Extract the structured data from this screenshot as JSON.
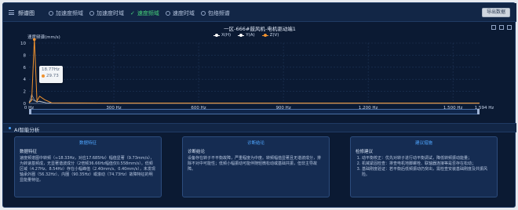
{
  "header": {
    "title": "频谱图",
    "options": [
      {
        "label": "加速度频域",
        "checked": false
      },
      {
        "label": "加速度时域",
        "checked": false
      },
      {
        "label": "速度频域",
        "checked": true
      },
      {
        "label": "速度时域",
        "checked": false
      },
      {
        "label": "包络频谱",
        "checked": false
      }
    ],
    "export_label": "导出数据"
  },
  "chart": {
    "title": "一区-666#鼓风机-电机驱动端1",
    "ylabel": "速度频谱(mm/s)",
    "legend": [
      {
        "name": "X(H)",
        "color": "#ffffff"
      },
      {
        "name": "Y(A)",
        "color": "#ffffff"
      },
      {
        "name": "Z(V)",
        "color": "#f0922e"
      }
    ],
    "tooltip": {
      "freq": "18.77Hz",
      "value": "29.73"
    }
  },
  "chart_data": {
    "type": "line",
    "title": "一区-666#鼓风机-电机驱动端1",
    "ylabel": "速度频谱(mm/s)",
    "xlabel": "",
    "xlim": [
      0,
      1594
    ],
    "ylim": [
      0,
      10
    ],
    "x_ticks": [
      "0 Hz",
      "300 Hz",
      "600 Hz",
      "900 Hz",
      "1,200 Hz",
      "1,500 Hz",
      "1,594 Hz"
    ],
    "y_ticks": [
      "0",
      "2",
      "4",
      "6",
      "8",
      "10"
    ],
    "series": [
      {
        "name": "X(H)",
        "color": "#ffffff",
        "points": [
          [
            0,
            0.1
          ],
          [
            9.4,
            1.5
          ],
          [
            18.77,
            0.6
          ],
          [
            28,
            0.2
          ],
          [
            37.5,
            0.4
          ],
          [
            60,
            0.1
          ],
          [
            300,
            0.05
          ],
          [
            600,
            0.05
          ],
          [
            900,
            0.05
          ],
          [
            1200,
            0.05
          ],
          [
            1594,
            0.05
          ]
        ]
      },
      {
        "name": "Y(A)",
        "color": "#ffffff",
        "points": [
          [
            0,
            0.1
          ],
          [
            9.4,
            0.8
          ],
          [
            18.77,
            0.4
          ],
          [
            37.5,
            0.3
          ],
          [
            60,
            0.1
          ],
          [
            300,
            0.05
          ],
          [
            600,
            0.05
          ],
          [
            900,
            0.05
          ],
          [
            1200,
            0.05
          ],
          [
            1594,
            0.05
          ]
        ]
      },
      {
        "name": "Z(V)",
        "color": "#f0922e",
        "points": [
          [
            0,
            0.1
          ],
          [
            9.4,
            0.5
          ],
          [
            18.77,
            29.73
          ],
          [
            28,
            0.4
          ],
          [
            37.5,
            1.2
          ],
          [
            56,
            0.6
          ],
          [
            80,
            0.1
          ],
          [
            300,
            0.05
          ],
          [
            600,
            0.05
          ],
          [
            900,
            0.05
          ],
          [
            1200,
            0.05
          ],
          [
            1594,
            0.05
          ]
        ]
      }
    ],
    "grid": true,
    "legend_position": "top-center"
  },
  "ai": {
    "title": "AI智能分析",
    "cards": [
      {
        "title": "数据特征",
        "subtitle": "数据特征",
        "body": "速度频谱图中转频（≈18.33Hz，对应17.685Hz）幅值显著（9.73mm/s），为转速基频成，无显著谐波成分（2倍频36.66Hz幅值仅0.558mm/s）。低频区域（4.27Hz、8.54Hz）存在小幅峰值（2.40mm/s、0.40mm/s），未发现轴承外圈（56.32Hz）、内圈（90.35Hz）或滚动（74.73Hz）故障特征的明显能量特征。"
      },
      {
        "title": "诊断结论",
        "subtitle": "诊断结论",
        "body": "设备存在转子不平衡故障，严重程度为中度。转频幅值显著且无谐波成分，排除不对中可能性；低频小幅振动可能伴随轻微松动或基础共振，但非主导故障。"
      },
      {
        "title": "建议措施",
        "subtitle": "检修建议",
        "items": [
          "动平衡校正：优先对转子进行动平衡调试，降低转频振动能量；",
          "机械紧固检查：排查电机地脚螺栓、联轴器连接等是否存在松动；",
          "基础刚度验证：若平衡后低频振动仍突出，需检查安装基础刚度及共振风险。"
        ]
      }
    ]
  }
}
